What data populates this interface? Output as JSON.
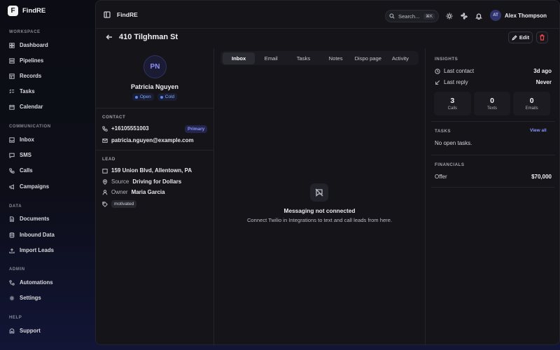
{
  "brand": {
    "logo_letter": "F",
    "name": "FindRE"
  },
  "sidebar": {
    "sections": [
      {
        "title": "WORKSPACE",
        "items": [
          {
            "label": "Dashboard",
            "icon": "dashboard-icon"
          },
          {
            "label": "Pipelines",
            "icon": "pipelines-icon"
          },
          {
            "label": "Records",
            "icon": "records-icon"
          },
          {
            "label": "Tasks",
            "icon": "tasks-icon"
          },
          {
            "label": "Calendar",
            "icon": "calendar-icon"
          }
        ]
      },
      {
        "title": "COMMUNICATION",
        "items": [
          {
            "label": "Inbox",
            "icon": "inbox-icon"
          },
          {
            "label": "SMS",
            "icon": "sms-icon"
          },
          {
            "label": "Calls",
            "icon": "phone-icon"
          },
          {
            "label": "Campaigns",
            "icon": "megaphone-icon"
          }
        ]
      },
      {
        "title": "DATA",
        "items": [
          {
            "label": "Documents",
            "icon": "document-icon"
          },
          {
            "label": "Inbound Data",
            "icon": "database-icon"
          },
          {
            "label": "Import Leads",
            "icon": "upload-icon"
          }
        ]
      },
      {
        "title": "ADMIN",
        "items": [
          {
            "label": "Automations",
            "icon": "automation-icon"
          },
          {
            "label": "Settings",
            "icon": "gear-icon"
          }
        ]
      },
      {
        "title": "HELP",
        "items": [
          {
            "label": "Support",
            "icon": "support-icon"
          }
        ]
      }
    ]
  },
  "topbar": {
    "breadcrumb": "FindRE",
    "search_placeholder": "Search...",
    "search_shortcut": "⌘K",
    "user_initials": "AT",
    "user_name": "Alex Thompson"
  },
  "page": {
    "title": "410 Tilghman St",
    "edit_label": "Edit"
  },
  "lead": {
    "initials": "PN",
    "name": "Patricia Nguyen",
    "status_badges": [
      "Open",
      "Cold"
    ],
    "contact_label": "CONTACT",
    "phone": "+16105551003",
    "phone_tag": "Primary",
    "email": "patricia.nguyen@example.com",
    "lead_label": "LEAD",
    "address": "159 Union Blvd, Allentown, PA",
    "source_label": "Source",
    "source_value": "Driving for Dollars",
    "owner_label": "Owner",
    "owner_value": "Maria Garcia",
    "tag": "motivated"
  },
  "tabs": [
    "Inbox",
    "Email",
    "Tasks",
    "Notes",
    "Dispo page",
    "Activity"
  ],
  "active_tab": "Inbox",
  "empty_state": {
    "title": "Messaging not connected",
    "message": "Connect Twilio in Integrations to text and call leads from here."
  },
  "insights": {
    "label": "INSIGHTS",
    "last_contact_label": "Last contact",
    "last_contact_value": "3d ago",
    "last_reply_label": "Last reply",
    "last_reply_value": "Never",
    "stats": [
      {
        "value": "3",
        "label": "Calls"
      },
      {
        "value": "0",
        "label": "Texts"
      },
      {
        "value": "0",
        "label": "Emails"
      }
    ]
  },
  "tasks": {
    "label": "TASKS",
    "view_all": "View all",
    "empty": "No open tasks."
  },
  "financials": {
    "label": "FINANCIALS",
    "offer_label": "Offer",
    "offer_value": "$70,000"
  },
  "colors": {
    "accent": "#8d92ff",
    "status_blue": "#4f8dff",
    "danger": "#ef4444",
    "background": "#141419"
  }
}
